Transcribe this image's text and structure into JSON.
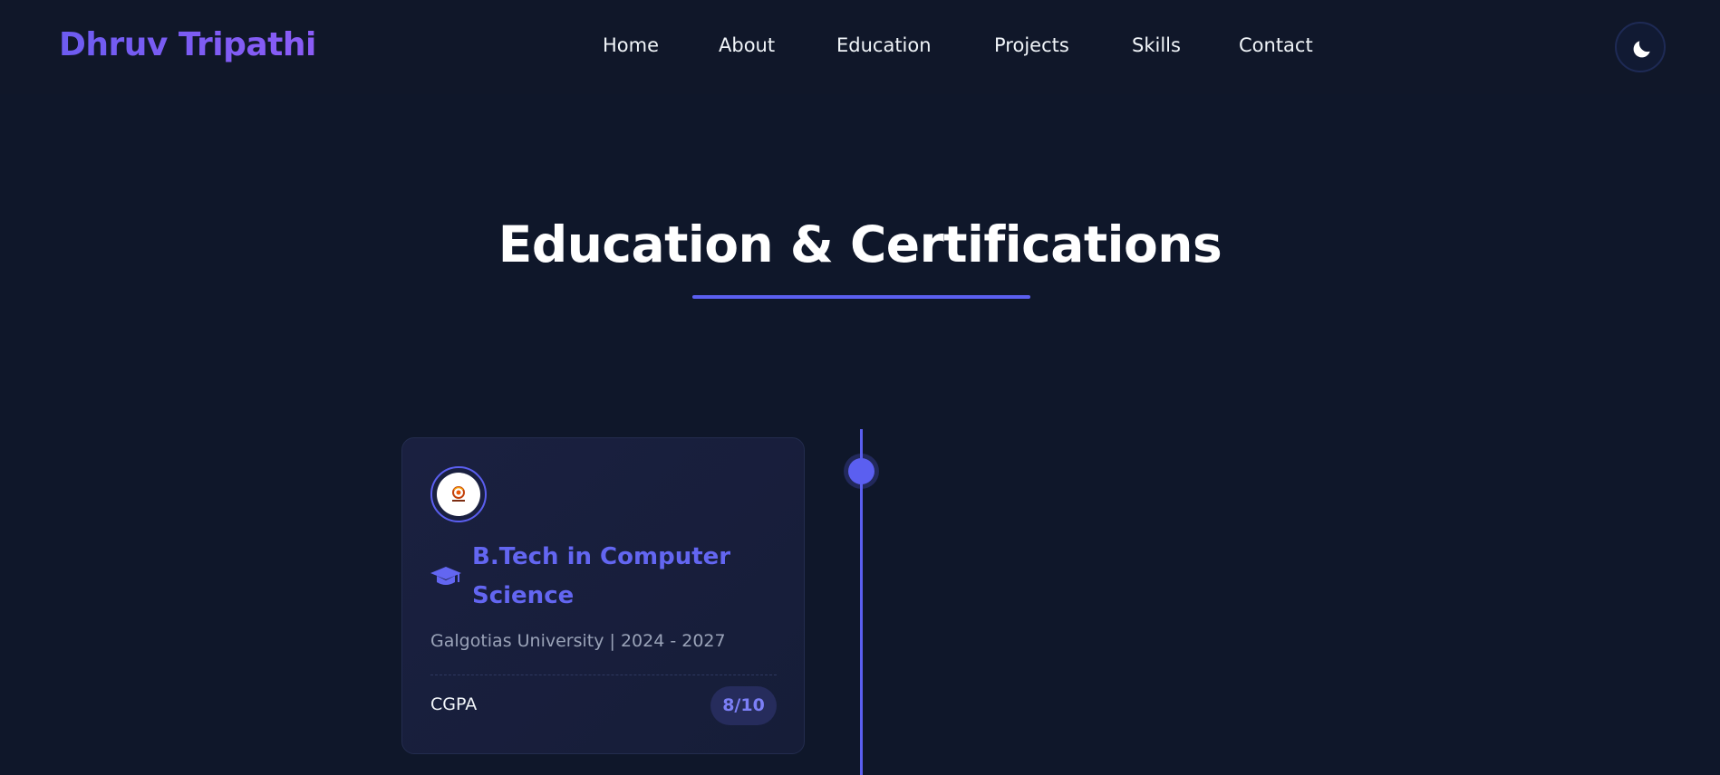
{
  "header": {
    "brand": "Dhruv Tripathi",
    "nav": [
      {
        "label": "Home"
      },
      {
        "label": "About"
      },
      {
        "label": "Education"
      },
      {
        "label": "Projects"
      },
      {
        "label": "Skills"
      },
      {
        "label": "Contact"
      }
    ],
    "theme_toggle_icon": "moon-icon"
  },
  "section": {
    "title": "Education & Certifications"
  },
  "education": [
    {
      "logo_icon": "university-logo",
      "degree_icon": "graduation-cap-icon",
      "degree": "B.Tech in Computer Science",
      "institution": "Galgotias University | 2024 - 2027",
      "metric_label": "CGPA",
      "metric_value": "8/10"
    }
  ],
  "colors": {
    "background": "#0f172a",
    "accent": "#6366f1",
    "brand": "#7c5cf5",
    "card": "#1a2040"
  }
}
